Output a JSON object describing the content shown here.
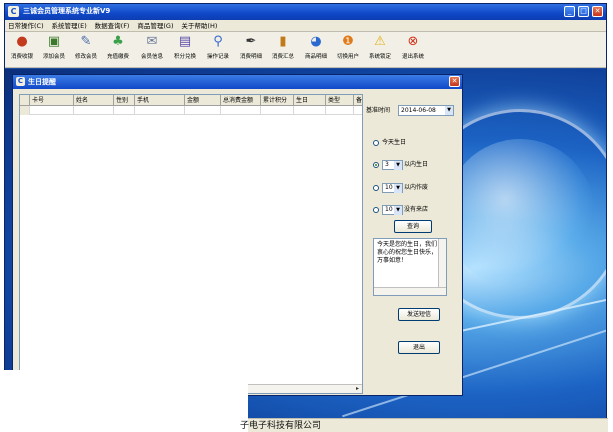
{
  "app": {
    "title": "三诚会员管理系统专业新V9"
  },
  "menu": [
    "日常操作(C)",
    "系统管理(E)",
    "数据查询(F)",
    "商品管理(G)",
    "关于帮助(H)"
  ],
  "toolbar": [
    {
      "label": "消费收银",
      "icon": "cashier-icon",
      "color": "#c43a1e"
    },
    {
      "label": "添加会员",
      "icon": "add-member-icon",
      "color": "#3a7a2a"
    },
    {
      "label": "修改会员",
      "icon": "edit-member-icon",
      "color": "#4a6aa8"
    },
    {
      "label": "充值缴费",
      "icon": "recharge-icon",
      "color": "#3aa04a"
    },
    {
      "label": "会员信息",
      "icon": "member-info-icon",
      "color": "#6a7a9a"
    },
    {
      "label": "积分兑换",
      "icon": "points-exchange-icon",
      "color": "#5a4aa8"
    },
    {
      "label": "操作记录",
      "icon": "search-icon",
      "color": "#3a6ad0"
    },
    {
      "label": "消费明细",
      "icon": "consumption-detail-icon",
      "color": "#333333"
    },
    {
      "label": "消费汇总",
      "icon": "consumption-summary-icon",
      "color": "#c07a1a"
    },
    {
      "label": "商品明细",
      "icon": "product-detail-icon",
      "color": "#2a6ad0"
    },
    {
      "label": "切换用户",
      "icon": "switch-user-icon",
      "color": "#e07a1a"
    },
    {
      "label": "系统锁定",
      "icon": "warning-icon",
      "color": "#e0b01a"
    },
    {
      "label": "退出系统",
      "icon": "exit-icon",
      "color": "#d0321a"
    }
  ],
  "dialog": {
    "title": "生日提醒",
    "columns": [
      "卡号",
      "姓名",
      "性别",
      "手机",
      "金额",
      "总消费金额",
      "累计积分",
      "生日",
      "类型",
      "备"
    ],
    "base_time_label": "基准时间",
    "base_time_value": "2014-06-08",
    "radios": [
      {
        "prefix": "",
        "value": "",
        "text": "今天生日",
        "selected": false
      },
      {
        "prefix": "",
        "value": "3",
        "text": "以内生日",
        "selected": true
      },
      {
        "prefix": "",
        "value": "10",
        "text": "以内作废",
        "selected": false
      },
      {
        "prefix": "",
        "value": "10",
        "text": "没有来店",
        "selected": false
      }
    ],
    "query_button": "查询",
    "message": "今天是您的生日，我们衷心的祝您生日快乐，万事如意！",
    "send_sms_button": "发送短信",
    "exit_button": "退出"
  },
  "status": {
    "company": "子电子科技有限公司"
  },
  "colors": {
    "title_bar": "#1048c8",
    "dialog_bg": "#ece9d8",
    "desktop": "#1c63c4"
  }
}
